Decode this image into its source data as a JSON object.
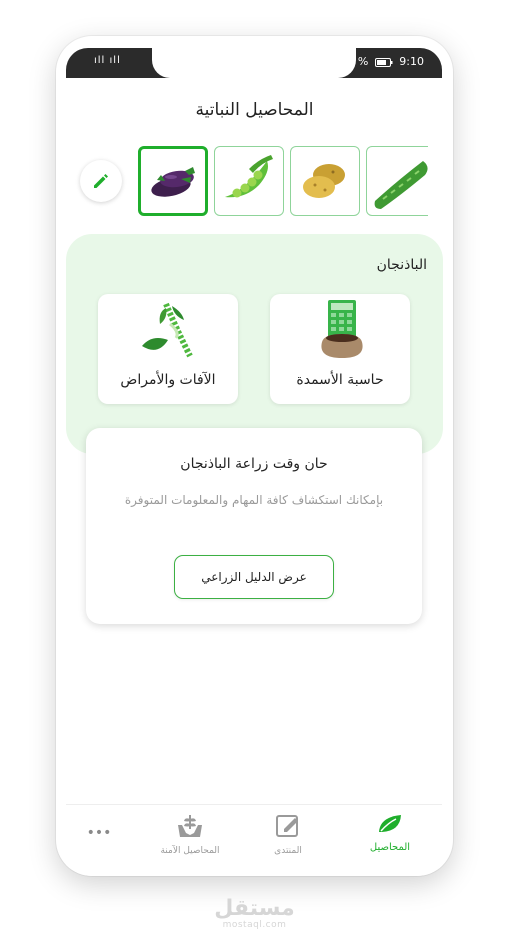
{
  "status_bar": {
    "signal": "ıll ıll",
    "battery_pct": "%",
    "time": "9:10"
  },
  "page_title": "المحاصيل النباتية",
  "crops": [
    {
      "name": "cucumber",
      "selected": false
    },
    {
      "name": "potato",
      "selected": false
    },
    {
      "name": "peas",
      "selected": false
    },
    {
      "name": "eggplant",
      "selected": true
    }
  ],
  "selected_crop": "الباذنجان",
  "tools": {
    "fertilizer": "حاسبة الأسمدة",
    "pests": "الآفات والأمراض"
  },
  "info_card": {
    "title": "حان وقت زراعة الباذنجان",
    "description": "بإمكانك استكشاف كافة المهام  والمعلومات المتوفرة",
    "button": "عرض الدليل الزراعي"
  },
  "nav": {
    "crops": "المحاصيل",
    "forum": "المنتدى",
    "safe_crops": "المحاصيل الآمنة",
    "more": "•••"
  },
  "watermark": {
    "main": "مستقل",
    "sub": "mostaql.com"
  },
  "colors": {
    "accent": "#1fae2c",
    "panel": "#e8f8e8"
  }
}
